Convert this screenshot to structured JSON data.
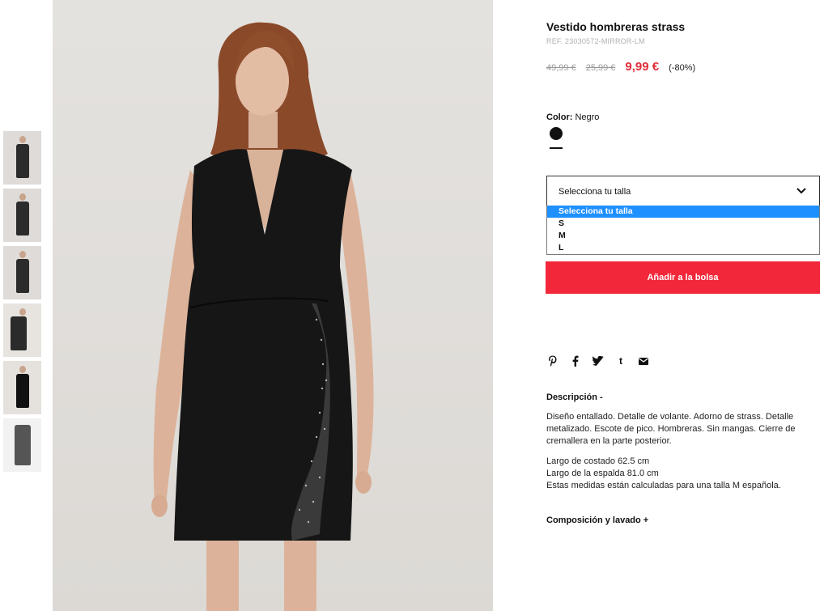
{
  "product": {
    "title": "Vestido hombreras strass",
    "ref": "REF. 23030572-MIRROR-LM",
    "price_original": "49,99 €",
    "price_previous": "25,99 €",
    "price_now": "9,99 €",
    "discount": "(-80%)"
  },
  "color": {
    "label": "Color:",
    "value": "Negro",
    "swatch_hex": "#111111"
  },
  "size_select": {
    "current": "Selecciona tu talla",
    "options": [
      "Selecciona tu talla",
      "S",
      "M",
      "L"
    ],
    "highlighted_index": 0
  },
  "add_to_bag": "Añadir a la bolsa",
  "share_icons": [
    "pinterest-icon",
    "facebook-icon",
    "twitter-icon",
    "tumblr-icon",
    "email-icon"
  ],
  "description": {
    "heading": "Descripción -",
    "paragraph1": "Diseño entallado. Detalle de volante. Adorno de strass. Detalle metalizado. Escote de pico. Hombreras. Sin mangas. Cierre de cremallera en la parte posterior.",
    "line1": "Largo de costado 62.5 cm",
    "line2": "Largo de la espalda 81.0 cm",
    "line3": "Estas medidas están calculadas para una talla M española."
  },
  "composition_heading": "Composición y lavado +",
  "colors": {
    "accent_red": "#f2283a",
    "price_red": "#e22d3a",
    "select_highlight": "#1e90ff"
  }
}
